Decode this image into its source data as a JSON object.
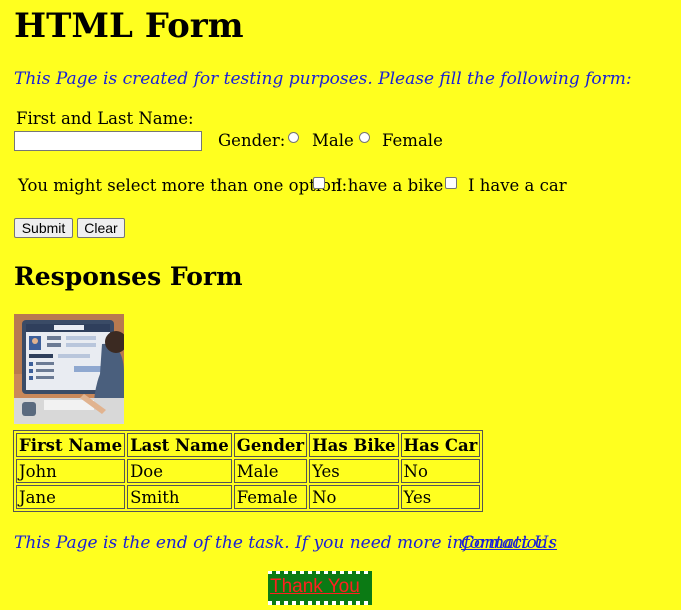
{
  "page": {
    "title": "HTML Form",
    "intro": "This Page is created for testing purposes. Please fill the following form:"
  },
  "form": {
    "name_label": "First and Last Name:",
    "name_value": "",
    "gender_label": "Gender:",
    "gender_options": [
      "Male",
      "Female"
    ],
    "options_label": "You might select more than one option:",
    "checkbox_options": [
      "I have a bike",
      "I have a car"
    ],
    "submit_label": "Submit",
    "clear_label": "Clear"
  },
  "responses": {
    "title": "Responses Form",
    "image_alt": "person filling an online form",
    "headers": [
      "First Name",
      "Last Name",
      "Gender",
      "Has Bike",
      "Has Car"
    ],
    "rows": [
      [
        "John",
        "Doe",
        "Male",
        "Yes",
        "No"
      ],
      [
        "Jane",
        "Smith",
        "Female",
        "No",
        "Yes"
      ]
    ]
  },
  "footer": {
    "note": "This Page is the end of the task. If you need more information:",
    "contact_label": "Contact Us",
    "thanks_label": "Thank You"
  },
  "colors": {
    "background": "#ffff1f",
    "italic_text": "#1a20d6",
    "thanks_bg": "#0b7a14",
    "thanks_text": "#ff2020"
  }
}
